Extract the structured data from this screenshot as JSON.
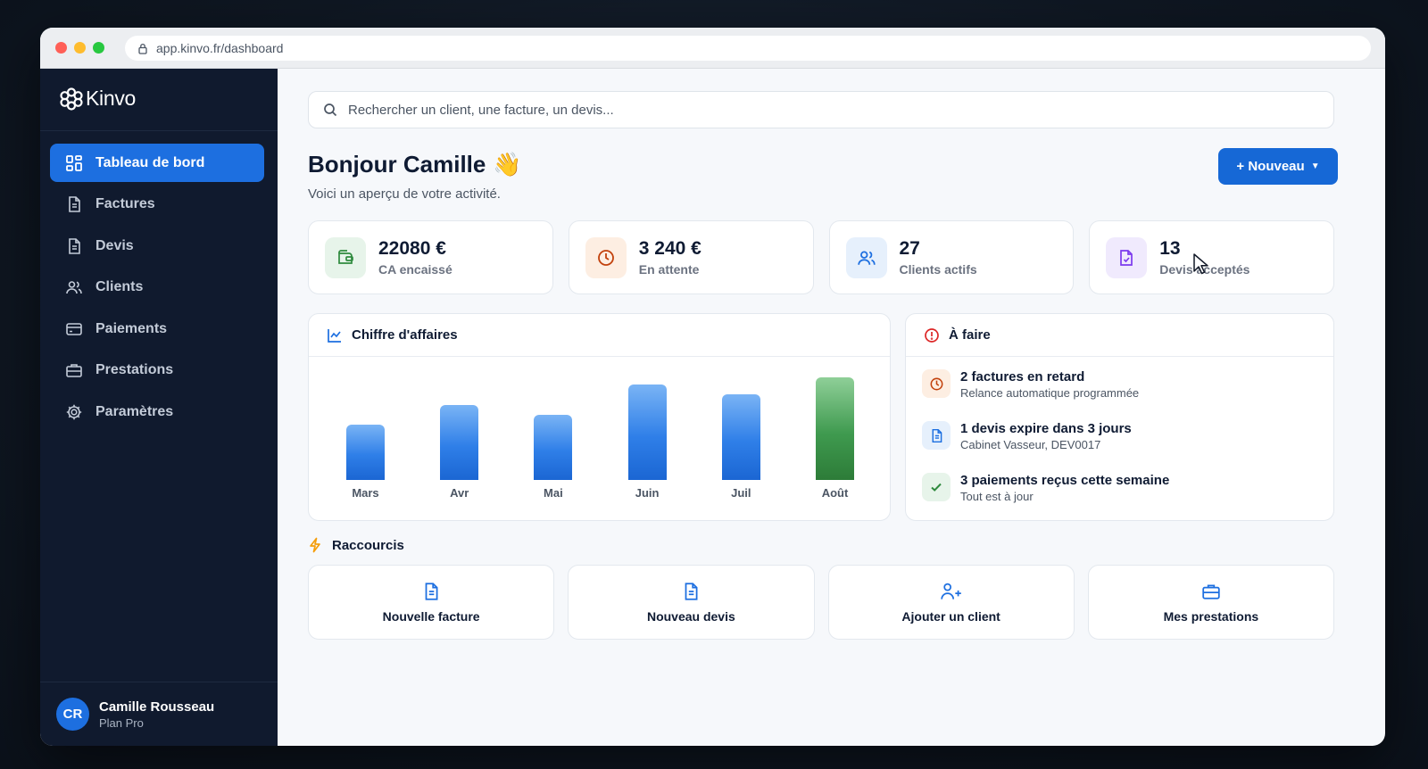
{
  "browser": {
    "url": "app.kinvo.fr/dashboard"
  },
  "app": {
    "name": "Kinvo"
  },
  "sidebar": {
    "items": [
      {
        "label": "Tableau de bord",
        "icon": "dashboard-icon",
        "active": true
      },
      {
        "label": "Factures",
        "icon": "document-icon"
      },
      {
        "label": "Devis",
        "icon": "document-icon"
      },
      {
        "label": "Clients",
        "icon": "users-icon"
      },
      {
        "label": "Paiements",
        "icon": "credit-card-icon"
      },
      {
        "label": "Prestations",
        "icon": "briefcase-icon"
      },
      {
        "label": "Paramètres",
        "icon": "gear-icon"
      }
    ]
  },
  "user": {
    "initials": "CR",
    "name": "Camille Rousseau",
    "plan": "Plan Pro"
  },
  "search": {
    "placeholder": "Rechercher un client, une facture, un devis..."
  },
  "header": {
    "greeting": "Bonjour Camille",
    "emoji": "👋",
    "subtitle": "Voici un aperçu de votre activité.",
    "new_button": "+ Nouveau"
  },
  "stats": [
    {
      "value": "22080 €",
      "label": "CA encaissé",
      "icon": "wallet-icon",
      "color": "#2f8a3e",
      "bg": "#e7f4ea"
    },
    {
      "value": "3 240 €",
      "label": "En attente",
      "icon": "clock-icon",
      "color": "#c2410c",
      "bg": "#fdeee2"
    },
    {
      "value": "27",
      "label": "Clients actifs",
      "icon": "users-icon",
      "color": "#1d6fe0",
      "bg": "#e6f0fc"
    },
    {
      "value": "13",
      "label": "Devis acceptés",
      "icon": "document-check-icon",
      "color": "#7c3aed",
      "bg": "#f0eafd"
    }
  ],
  "revenue": {
    "title": "Chiffre d'affaires",
    "chart_data": {
      "type": "bar",
      "categories": [
        "Mars",
        "Avr",
        "Mai",
        "Juin",
        "Juil",
        "Août"
      ],
      "values": [
        5.5,
        7.5,
        6.5,
        9.5,
        8.5,
        10.2
      ],
      "highlight_index": 5,
      "colors": {
        "bar": "#2f7fe8",
        "highlight": "#3f9a4f"
      },
      "ylim": [
        0,
        10.5
      ],
      "grid": false,
      "legend": "none",
      "title": "Chiffre d'affaires",
      "xlabel": "",
      "ylabel": ""
    }
  },
  "todo": {
    "title": "À faire",
    "items": [
      {
        "title": "2 factures en retard",
        "subtitle": "Relance automatique programmée",
        "icon": "clock-icon",
        "color": "#c2410c",
        "bg": "#fdeee2"
      },
      {
        "title": "1 devis expire dans 3 jours",
        "subtitle": "Cabinet Vasseur, DEV0017",
        "icon": "document-icon",
        "color": "#1d6fe0",
        "bg": "#e6f0fc"
      },
      {
        "title": "3 paiements reçus cette semaine",
        "subtitle": "Tout est à jour",
        "icon": "check-icon",
        "color": "#2f8a3e",
        "bg": "#e7f4ea"
      }
    ]
  },
  "shortcuts": {
    "title": "Raccourcis",
    "items": [
      {
        "label": "Nouvelle facture",
        "icon": "document-icon"
      },
      {
        "label": "Nouveau devis",
        "icon": "document-icon"
      },
      {
        "label": "Ajouter un client",
        "icon": "user-plus-icon"
      },
      {
        "label": "Mes prestations",
        "icon": "briefcase-icon"
      }
    ]
  }
}
